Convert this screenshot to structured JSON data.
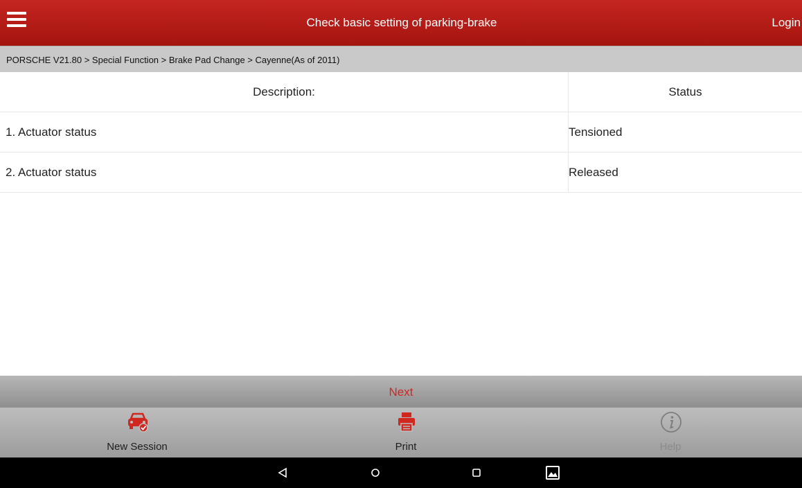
{
  "header": {
    "title": "Check basic setting of parking-brake",
    "login_label": "Login"
  },
  "breadcrumb": "PORSCHE V21.80 > Special Function > Brake Pad Change > Cayenne(As of 2011)",
  "table": {
    "columns": [
      "Description:",
      "Status"
    ],
    "rows": [
      {
        "description": "1. Actuator status",
        "status": "Tensioned"
      },
      {
        "description": "2. Actuator status",
        "status": "Released"
      }
    ]
  },
  "next_label": "Next",
  "bottom_bar": [
    {
      "label": "New Session",
      "icon": "car-check-icon",
      "enabled": true
    },
    {
      "label": "Print",
      "icon": "printer-icon",
      "enabled": true
    },
    {
      "label": "Help",
      "icon": "info-icon",
      "enabled": false
    }
  ],
  "android_nav": [
    "back-icon",
    "home-icon",
    "recents-icon",
    "screenshot-icon"
  ],
  "colors": {
    "header_red": "#b31a15",
    "accent_red": "#d0271f"
  }
}
